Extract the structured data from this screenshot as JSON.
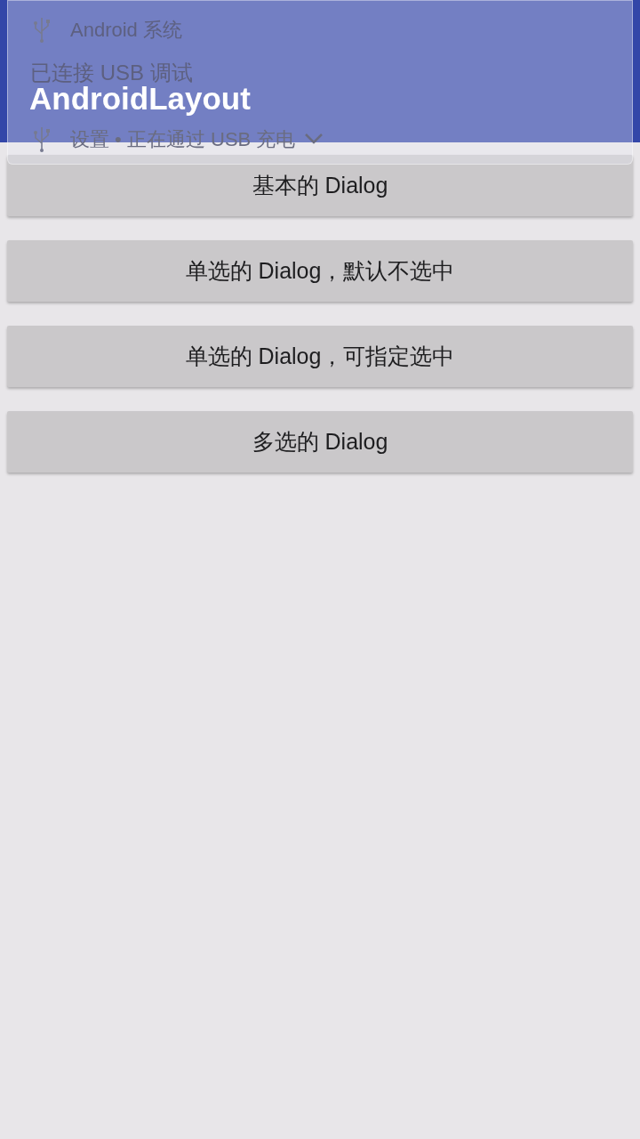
{
  "app_bar": {
    "title": "AndroidLayout"
  },
  "buttons": [
    {
      "label": "基本的 Dialog"
    },
    {
      "label": "单选的 Dialog，默认不选中"
    },
    {
      "label": "单选的 Dialog，可指定选中"
    },
    {
      "label": "多选的 Dialog"
    }
  ],
  "notification": {
    "app_name": "Android 系统",
    "title": "已连接 USB 调试",
    "footer": "设置 • 正在通过 USB 充电"
  }
}
